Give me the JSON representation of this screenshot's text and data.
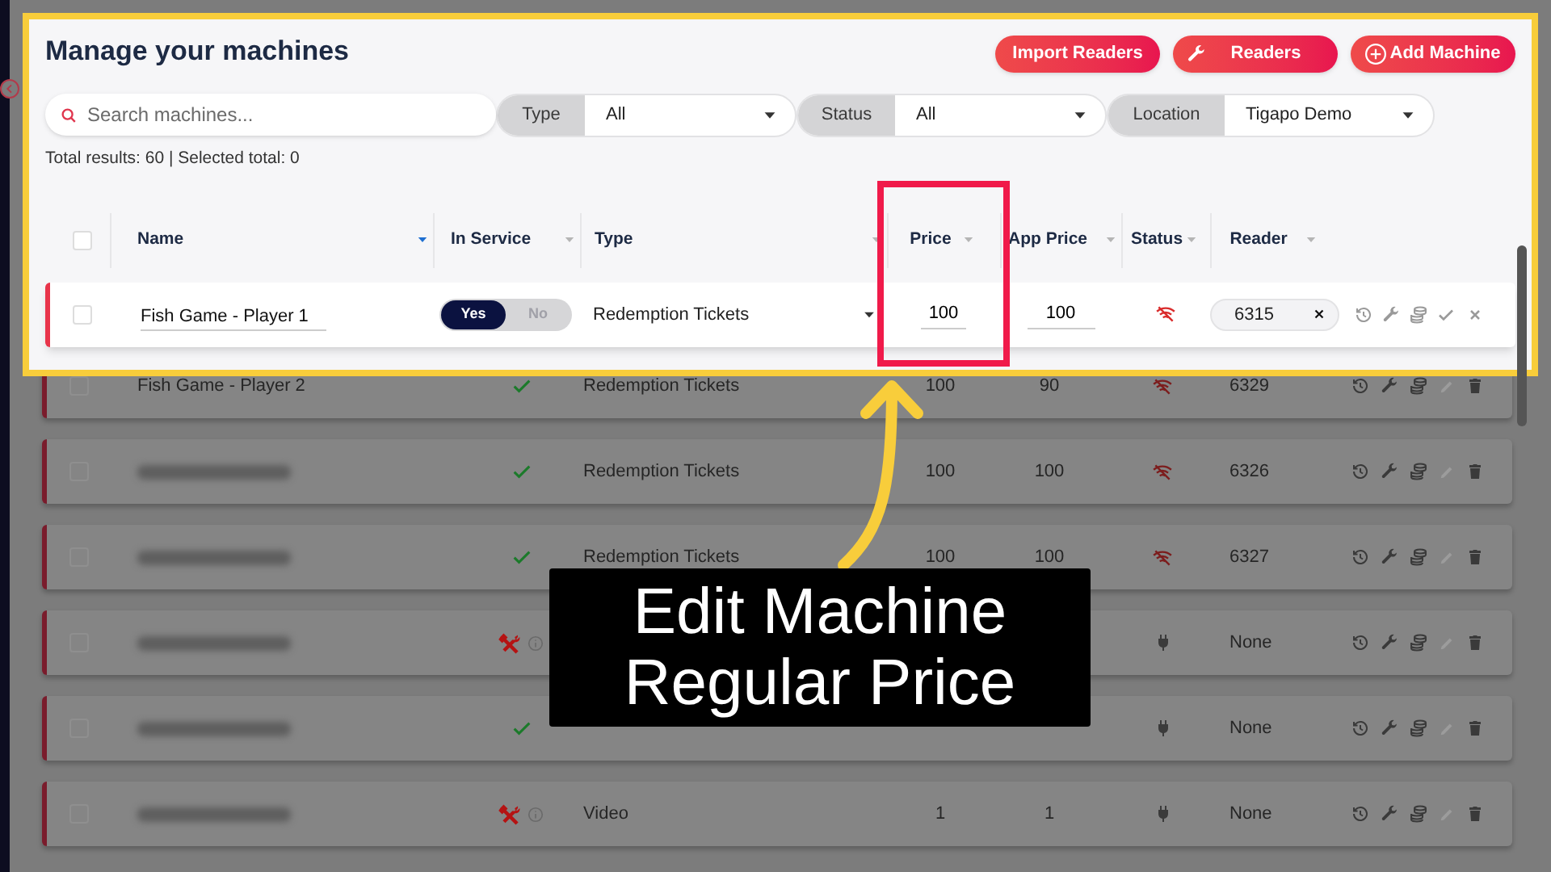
{
  "page": {
    "title": "Manage your machines"
  },
  "actions": [
    {
      "label": "Import Readers",
      "kind": "plain"
    },
    {
      "label": "Readers",
      "kind": "wrench"
    },
    {
      "label": "Add Machine",
      "kind": "plus"
    }
  ],
  "search": {
    "placeholder": "Search machines..."
  },
  "filters": [
    {
      "label": "Type",
      "value": "All"
    },
    {
      "label": "Status",
      "value": "All"
    },
    {
      "label": "Location",
      "value": "Tigapo Demo"
    }
  ],
  "totals": "Total results: 60 | Selected total: 0",
  "table": {
    "select_all": {
      "checked": false
    },
    "columns": [
      {
        "label": "Name",
        "sorted": true
      },
      {
        "label": "In Service",
        "sorted": false
      },
      {
        "label": "Type",
        "sorted": false
      },
      {
        "label": "Price",
        "sorted": false
      },
      {
        "label": "App Price",
        "sorted": false
      },
      {
        "label": "Status",
        "sorted": false
      },
      {
        "label": "Reader",
        "sorted": false
      }
    ],
    "editing_row": {
      "checked": false,
      "name": "Fish Game - Player 1",
      "in_service": [
        {
          "label": "Yes",
          "selected": true
        },
        {
          "label": "No",
          "selected": false
        }
      ],
      "type": "Redemption Tickets",
      "price": "100",
      "app_price": "100",
      "status": {
        "kind": "offline"
      },
      "reader": "6315"
    },
    "rows": [
      {
        "checked": false,
        "name": "Fish Game - Player 2",
        "blurred": false,
        "in_service": true,
        "type": "Redemption Tickets",
        "price": "100",
        "app_price": "90",
        "status": {
          "kind": "offline"
        },
        "reader": "6329"
      },
      {
        "checked": false,
        "blurred": true,
        "in_service": true,
        "type": "Redemption Tickets",
        "price": "100",
        "app_price": "100",
        "status": {
          "kind": "offline"
        },
        "reader": "6326"
      },
      {
        "checked": false,
        "blurred": true,
        "in_service": true,
        "type": "Redemption Tickets",
        "price": "100",
        "app_price": "100",
        "status": {
          "kind": "offline"
        },
        "reader": "6327"
      },
      {
        "checked": false,
        "blurred": true,
        "in_service": false,
        "status": {
          "kind": "plugged"
        },
        "reader": "None"
      },
      {
        "checked": false,
        "blurred": true,
        "in_service": true,
        "status": {
          "kind": "plugged"
        },
        "reader": "None"
      },
      {
        "checked": false,
        "blurred": true,
        "in_service": false,
        "type": "Video",
        "price": "1",
        "app_price": "1",
        "status": {
          "kind": "plugged"
        },
        "reader": "None"
      }
    ]
  },
  "callout": {
    "lines": [
      "Edit Machine",
      "Regular Price"
    ]
  }
}
